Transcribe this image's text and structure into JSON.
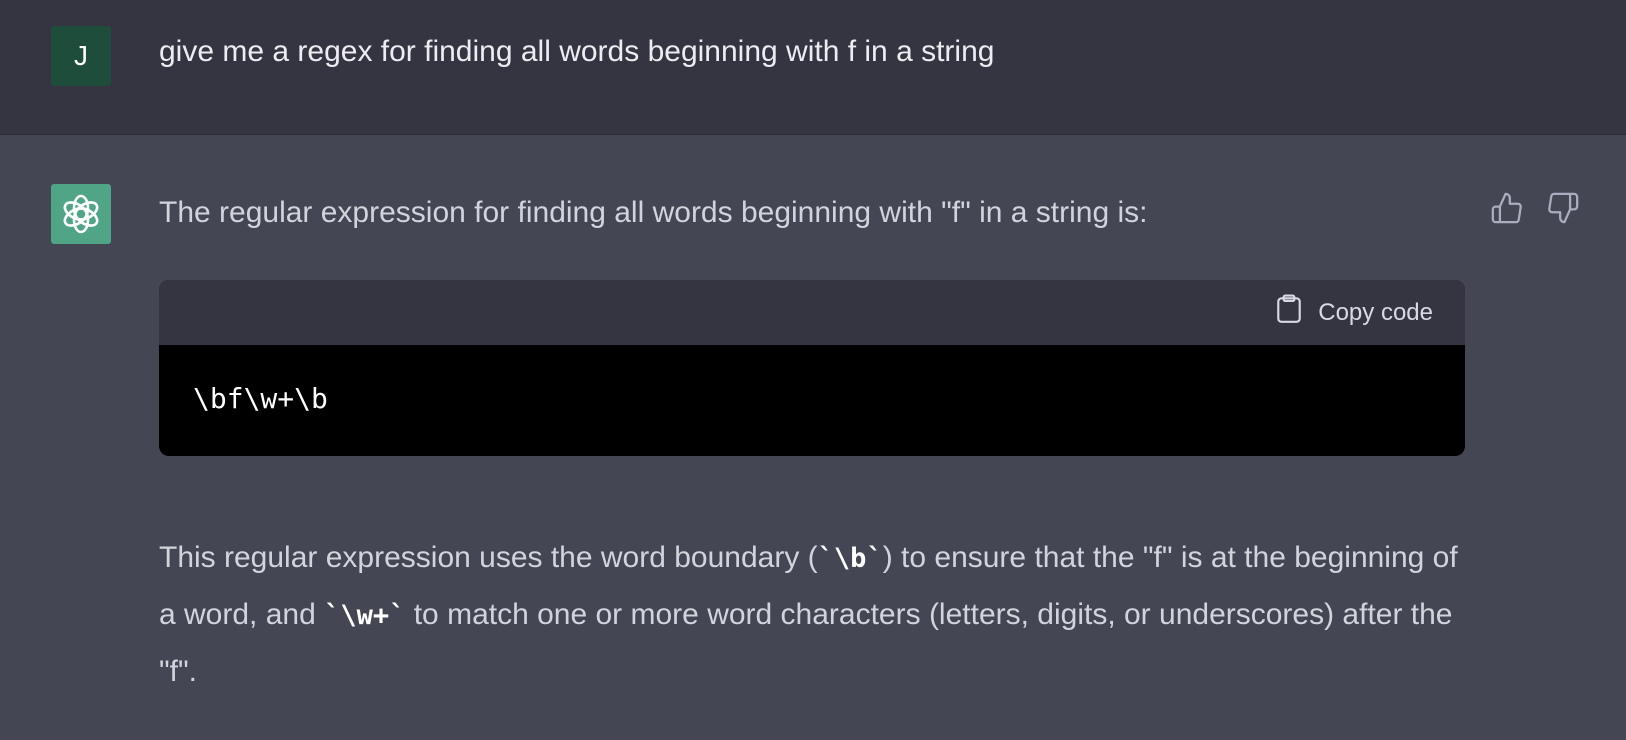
{
  "user_message": {
    "avatar_letter": "J",
    "text": "give me a regex for finding all words beginning with f in a string"
  },
  "assistant_message": {
    "avatar_icon": "openai-logo-icon",
    "intro": "The regular expression for finding all words beginning with \"f\" in a string is:",
    "feedback": {
      "thumbs_up_icon": "thumbs-up-icon",
      "thumbs_down_icon": "thumbs-down-icon"
    },
    "code_block": {
      "copy_label": "Copy code",
      "code": "\\bf\\w+\\b"
    },
    "explanation": {
      "part1": "This regular expression uses the word boundary (",
      "code1": "`\\b`",
      "part2": ") to ensure that the \"f\" is at the beginning of a word, and ",
      "code2": "`\\w+`",
      "part3": " to match one or more word characters (letters, digits, or underscores) after the \"f\"."
    }
  },
  "colors": {
    "user_bg": "#343541",
    "assistant_bg": "#444654",
    "user_avatar_bg": "#1f4d3c",
    "assistant_avatar_bg": "#4fa585",
    "code_bg": "#000000",
    "code_header_bg": "#343541"
  }
}
